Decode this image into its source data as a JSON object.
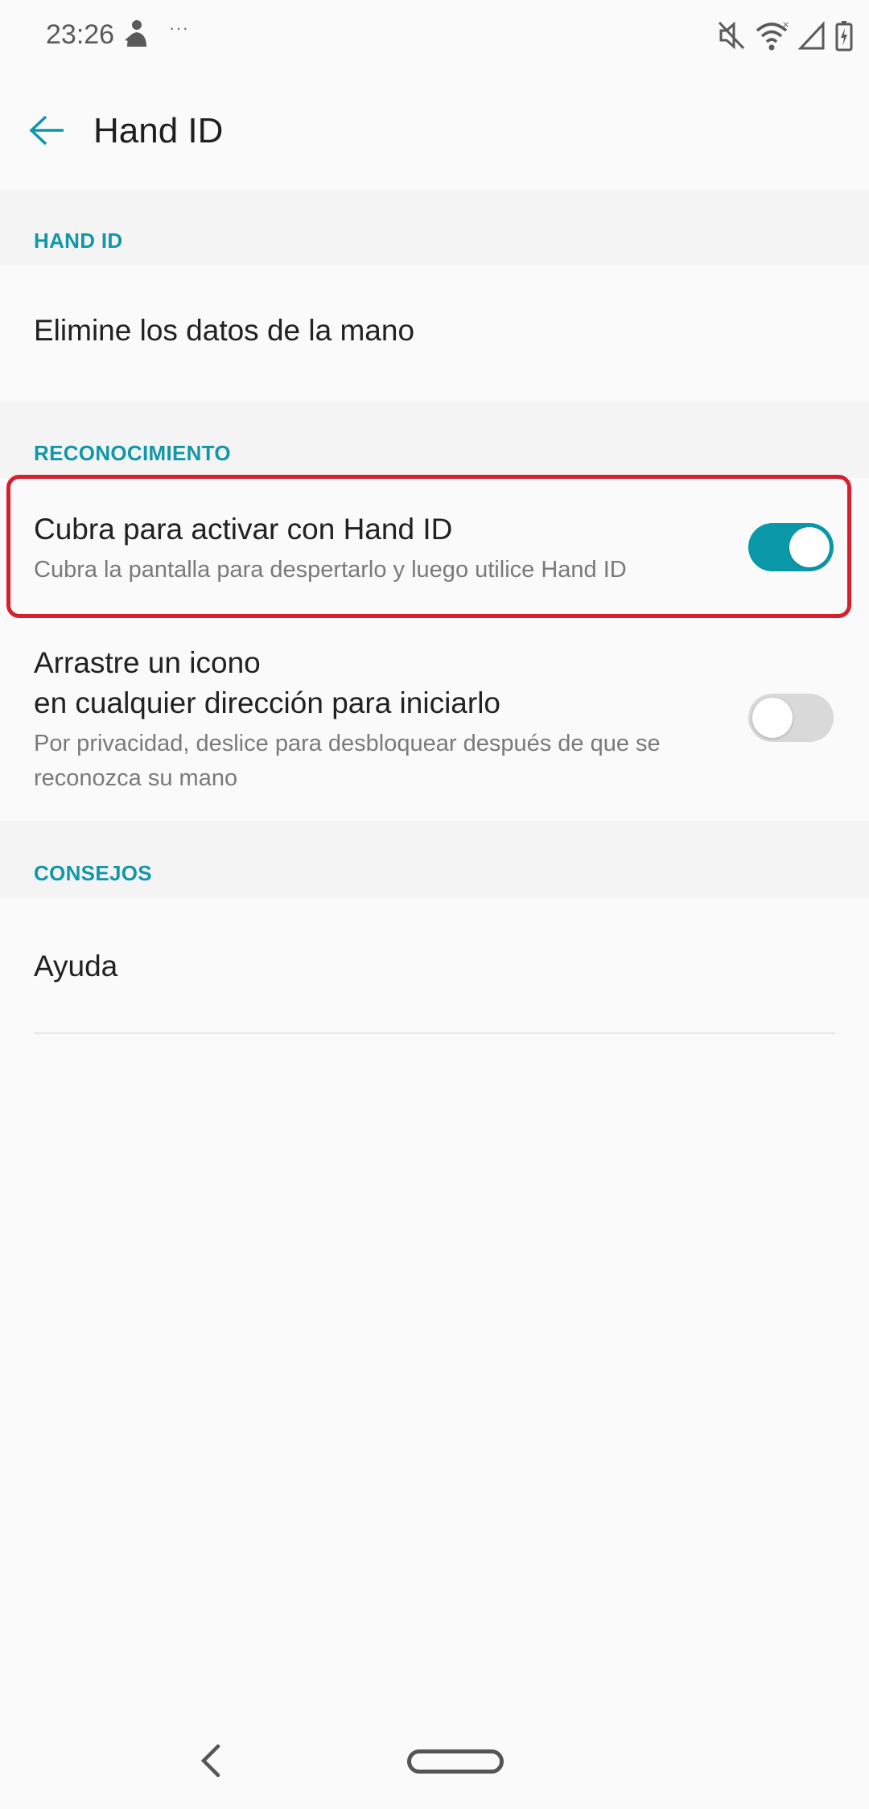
{
  "status_bar": {
    "time": "23:26",
    "more_indicator": "···",
    "icons": [
      "notification-icon",
      "mute-icon",
      "wifi-icon",
      "signal-icon",
      "battery-icon"
    ]
  },
  "app_bar": {
    "title": "Hand ID"
  },
  "sections": {
    "hand_id": {
      "header": "HAND ID",
      "delete_item": {
        "title": "Elimine los datos de la mano"
      }
    },
    "recognition": {
      "header": "RECONOCIMIENTO",
      "cover_to_activate": {
        "title": "Cubra para activar con Hand ID",
        "subtitle": "Cubra la pantalla para despertarlo y luego utilice Hand ID",
        "enabled": true
      },
      "drag_icon": {
        "title_line1": "Arrastre un icono",
        "title_line2": "en cualquier dirección para iniciarlo",
        "subtitle_line1": "Por privacidad, deslice para desbloquear después de que se",
        "subtitle_line2": "reconozca su mano",
        "enabled": false
      }
    },
    "tips": {
      "header": "CONSEJOS",
      "help_item": {
        "title": "Ayuda"
      }
    }
  },
  "colors": {
    "accent": "#0a97a8",
    "section_header": "#1297a8",
    "highlight": "#d7202d",
    "toggle_off": "#d9d9d9"
  }
}
